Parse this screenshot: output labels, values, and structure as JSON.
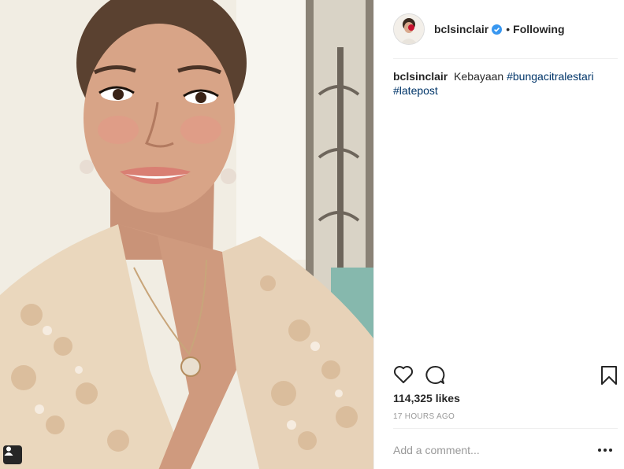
{
  "post": {
    "username": "bclsinclair",
    "follow_separator": "•",
    "follow_status": "Following",
    "caption": {
      "user": "bclsinclair",
      "text": "Kebayaan",
      "hashtags": [
        "#bungacitralestari",
        "#latepost"
      ]
    },
    "likes": "114,325 likes",
    "time": "17 HOURS AGO",
    "comment_placeholder": "Add a comment..."
  },
  "icons": {
    "verified": "verified-badge-icon",
    "like": "heart-icon",
    "comment": "comment-bubble-icon",
    "save": "bookmark-icon",
    "more": "more-options-icon",
    "tagged": "user-tag-icon"
  },
  "colors": {
    "verified_blue": "#3897f0",
    "hashtag": "#003569",
    "muted": "#999999",
    "text": "#262626"
  }
}
